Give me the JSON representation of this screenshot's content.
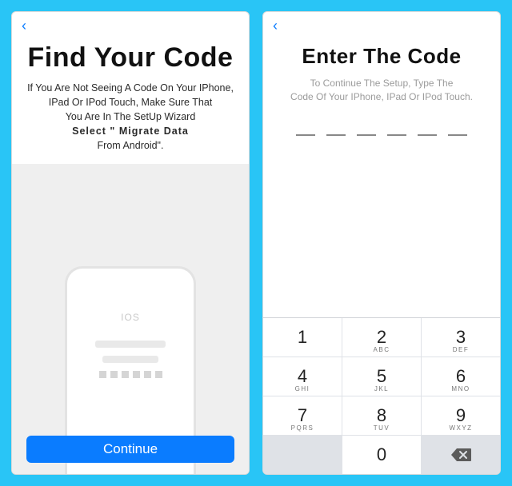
{
  "left": {
    "title": "Find Your Code",
    "desc_line1": "If You Are Not Seeing A Code On Your IPhone,",
    "desc_line2": "IPad Or IPod Touch, Make Sure That",
    "desc_line3": "You Are In The SetUp Wizard",
    "desc_select": "Select \" Migrate Data",
    "desc_line4": "From Android\".",
    "mock_label": "IOS",
    "continue_label": "Continue"
  },
  "right": {
    "title": "Enter The Code",
    "desc_line1": "To Continue The Setup, Type The",
    "desc_line2": "Code Of Your IPhone, IPad Or IPod Touch.",
    "code_length": 6
  },
  "keypad": {
    "keys": [
      {
        "main": "1",
        "sub": ""
      },
      {
        "main": "2",
        "sub": "ABC"
      },
      {
        "main": "3",
        "sub": "DEF"
      },
      {
        "main": "4",
        "sub": "GHI"
      },
      {
        "main": "5",
        "sub": "JKL"
      },
      {
        "main": "6",
        "sub": "MNO"
      },
      {
        "main": "7",
        "sub": "PQRS"
      },
      {
        "main": "8",
        "sub": "TUV"
      },
      {
        "main": "9",
        "sub": "WXYZ"
      }
    ],
    "zero": "0"
  }
}
